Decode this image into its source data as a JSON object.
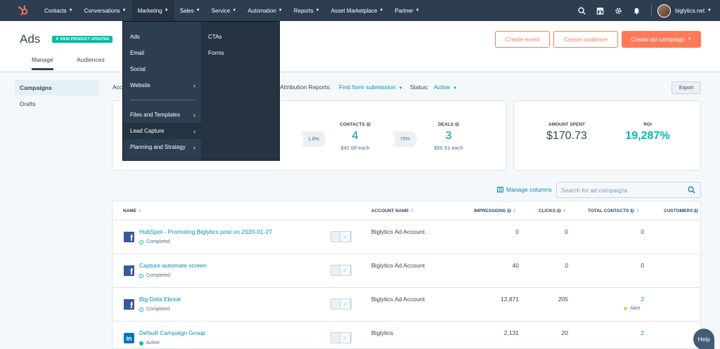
{
  "nav": {
    "items": [
      {
        "label": "Contacts"
      },
      {
        "label": "Conversations"
      },
      {
        "label": "Marketing"
      },
      {
        "label": "Sales"
      },
      {
        "label": "Service"
      },
      {
        "label": "Automation"
      },
      {
        "label": "Reports"
      },
      {
        "label": "Asset Marketplace"
      },
      {
        "label": "Partner"
      }
    ],
    "account": "biglytics.net"
  },
  "header": {
    "title": "Ads",
    "badge": "VIEW PRODUCT UPDATES",
    "tabs": [
      "Manage",
      "Audiences"
    ],
    "create_event": "Create event",
    "create_audience": "Create audience",
    "create_campaign": "Create ad campaign"
  },
  "sidebar": {
    "items": [
      "Campaigns",
      "Drafts"
    ]
  },
  "filters": {
    "acc_prefix": "Acc",
    "attribution_label": "Attribution Reports:",
    "attribution_value": "First form submission",
    "status_label": "Status:",
    "status_value": "Active",
    "export": "Export"
  },
  "metrics": {
    "contacts_label": "CONTACTS",
    "contacts_value": "4",
    "contacts_sub": "$42.68 each",
    "deals_label": "DEALS",
    "deals_value": "3",
    "deals_sub": "$56.91 each",
    "rate1": "1.8%",
    "rate2": "75%",
    "spent_label": "AMOUNT SPENT",
    "spent_value": "$170.73",
    "roi_label": "ROI",
    "roi_value": "19,287%"
  },
  "table": {
    "manage_columns": "Manage columns",
    "search_placeholder": "Search for ad campaigns",
    "headers": [
      "NAME",
      "ACCOUNT NAME",
      "IMPRESSIONS",
      "CLICKS",
      "TOTAL CONTACTS",
      "CUSTOMERS"
    ],
    "rows": [
      {
        "name": "HubSpot - Promoting Biglytics post on 2020-01-27",
        "status": "Completed",
        "account": "Biglytics Ad Account",
        "impressions": "0",
        "clicks": "0",
        "contacts": "0",
        "network": "facebook"
      },
      {
        "name": "Capture automate screen",
        "status": "Completed",
        "account": "Biglytics Ad Account",
        "impressions": "40",
        "clicks": "0",
        "contacts": "0",
        "network": "facebook"
      },
      {
        "name": "Big Data Ebook",
        "status": "Completed",
        "account": "Biglytics Ad Account",
        "impressions": "12,871",
        "clicks": "205",
        "contacts": "2",
        "contacts_note": "Alert",
        "network": "facebook"
      },
      {
        "name": "Default Campaign Group",
        "status": "Active",
        "account": "Biglytics",
        "impressions": "2,131",
        "clicks": "20",
        "contacts": "2",
        "network": "linkedin"
      }
    ]
  },
  "dropdown": {
    "col1": [
      "Ads",
      "Email",
      "Social",
      "Website",
      "Files and Templates",
      "Lead Capture",
      "Planning and Strategy"
    ],
    "col2": [
      "CTAs",
      "Forms"
    ]
  },
  "help": "Help",
  "colors": {
    "nav": "#2d3e50",
    "accent": "#ff7a59",
    "link": "#0091ae",
    "teal": "#00bda5"
  },
  "icons": {
    "fb": "f",
    "li": "in"
  }
}
